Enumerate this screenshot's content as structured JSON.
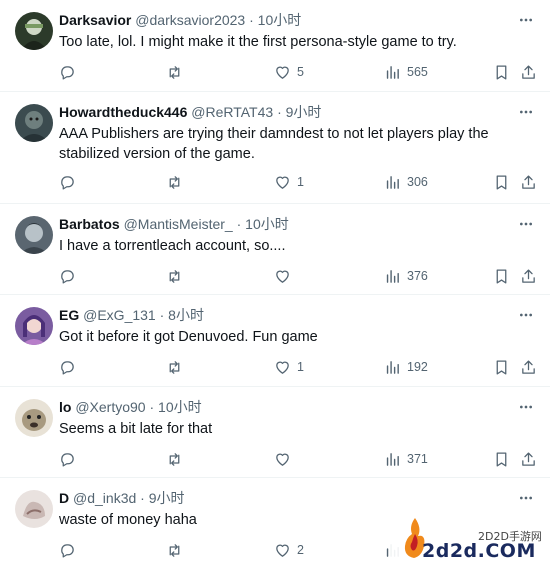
{
  "tweets": [
    {
      "name": "Darksavior",
      "handle": "@darksavior2023",
      "time": "10小时",
      "text": "Too late, lol. I might make it the first persona-style game to try.",
      "likes": "5",
      "views": "565",
      "avatar_color": "#2c3a2a"
    },
    {
      "name": "Howardtheduck446",
      "handle": "@ReRTAT43",
      "time": "9小时",
      "text": "AAA Publishers are trying their damndest to not let players play the stabilized version of the game.",
      "likes": "1",
      "views": "306",
      "avatar_color": "#3b4b4f"
    },
    {
      "name": "Barbatos",
      "handle": "@MantisMeister_",
      "time": "10小时",
      "text": "I have a torrentleach account, so....",
      "likes": "",
      "views": "376",
      "avatar_color": "#5a6670"
    },
    {
      "name": "EG",
      "handle": "@ExG_131",
      "time": "8小时",
      "text": "Got it before it got Denuvoed. Fun game",
      "likes": "1",
      "views": "192",
      "avatar_color": "#7a5ca0"
    },
    {
      "name": "lo",
      "handle": "@Xertyo90",
      "time": "10小时",
      "text": "Seems a bit late for that",
      "likes": "",
      "views": "371",
      "avatar_color": "#a89a80"
    },
    {
      "name": "D",
      "handle": "@d_ink3d",
      "time": "9小时",
      "text": "waste of money haha",
      "likes": "2",
      "views": "",
      "avatar_color": "#c9b8b4"
    }
  ],
  "separator": "·",
  "icons": {
    "reply": "reply-icon",
    "retweet": "retweet-icon",
    "like": "heart-icon",
    "views": "views-icon",
    "bookmark": "bookmark-icon",
    "share": "share-icon",
    "more": "more-icon"
  },
  "colors": {
    "text": "#0f1419",
    "secondary": "#536471",
    "border": "#eff3f4"
  },
  "watermark": {
    "site_cn": "2D2D手游网",
    "site_en": "2d2d.COM"
  }
}
